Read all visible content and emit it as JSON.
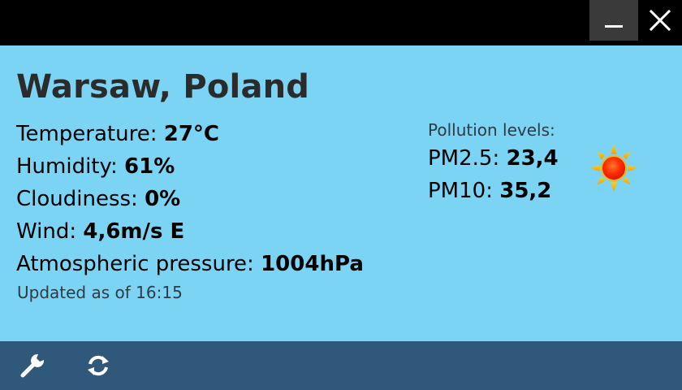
{
  "window": {
    "minimize_icon": "minimize-icon",
    "close_icon": "close-icon",
    "titlebar_color": "#000000"
  },
  "location": "Warsaw, Poland",
  "weather": {
    "temperature": {
      "label": "Temperature: ",
      "value": "27°C"
    },
    "humidity": {
      "label": "Humidity: ",
      "value": "61%"
    },
    "cloudiness": {
      "label": "Cloudiness: ",
      "value": "0%"
    },
    "wind": {
      "label": "Wind: ",
      "value": "4,6m/s E"
    },
    "pressure": {
      "label": "Atmospheric pressure: ",
      "value": "1004hPa"
    },
    "updated": "Updated as of 16:15",
    "condition_icon": "sun-icon"
  },
  "pollution": {
    "title": "Pollution levels:",
    "pm25": {
      "label": "PM2.5: ",
      "value": "23,4"
    },
    "pm10": {
      "label": "PM10: ",
      "value": "35,2"
    }
  },
  "toolbar": {
    "settings_icon": "wrench-icon",
    "refresh_icon": "refresh-icon"
  },
  "colors": {
    "background": "#7bd4f3",
    "toolbar": "#30587a",
    "sun": "#ff3b00"
  }
}
